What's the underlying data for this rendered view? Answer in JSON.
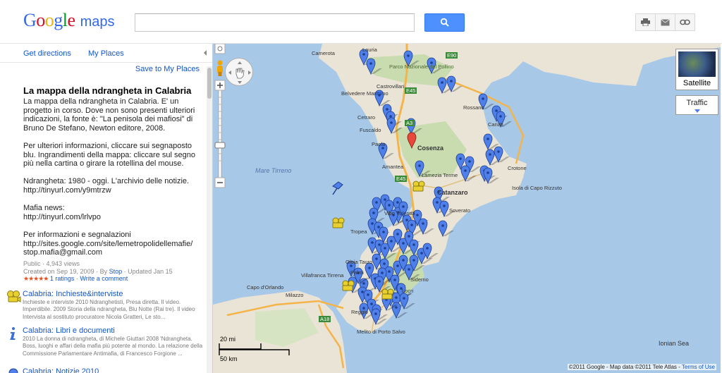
{
  "header": {
    "logo_text": "Google",
    "logo_suffix": "maps",
    "search": {
      "value": "",
      "placeholder": ""
    },
    "search_button_icon": "search-icon",
    "tools": [
      "print-icon",
      "email-icon",
      "link-icon"
    ]
  },
  "panel": {
    "tabs": [
      "Get directions",
      "My Places"
    ],
    "save_link": "Save to My Places",
    "title": "La mappa della ndrangheta in Calabria",
    "description": [
      "La mappa della ndrangheta in Calabria. E' un progetto in corso. Dove non sono presenti ulteriori indicazioni, la fonte è: \"La penisola dei mafiosi\" di Bruno De Stefano, Newton editore, 2008.",
      "Per ulteriori informazioni, cliccare sui segnaposto blu. Ingrandimenti della mappa: cliccare sul segno più nella cartina o girare la rotellina del mouse.",
      "Ndrangheta: 1980 - oggi. L'archivio delle notizie.\nhttp://tinyurl.com/y9mtrzw",
      "Mafia news:\nhttp://tinyurl.com/lrlvpo",
      "Per informazioni e segnalazioni\nhttp://sites.google.com/site/lemetropolidellemafie/\nstop.mafia@gmail.com"
    ],
    "meta": {
      "visibility": "Public · 4,943 views",
      "created": "Created on Sep 19, 2009 · By",
      "author": "Stop",
      "updated": "· Updated Jan 15",
      "stars": "★★★★★",
      "ratings": "1 ratings",
      "separator": "·",
      "write_comment": "Write a comment"
    },
    "layers": [
      {
        "title": "Calabria: Inchieste&interviste",
        "text": "Inchieste e interviste 2010 Ndranghetisti, Presa diretta. Il video. Imperdibile. 2009 Storia della ndrangheta, Blu Notte (Rai tre). Il video Intervista al sostituto procuratore Nicola Gratteri, Le sto..."
      },
      {
        "title": "Calabria: Libri e documenti",
        "text": "2010 La donna di ndrangheta, di Michele Giuttari 2008 'Ndrangheta. Boss, luoghi e affari della mafia più potente al mondo. La relazione della Commissione Parlamentare Antimafia, di Francesco Forgione ..."
      },
      {
        "title": "Calabria: Notizie 2010",
        "text": ""
      }
    ]
  },
  "map": {
    "satellite_label": "Satellite",
    "traffic_label": "Traffic",
    "scale": {
      "top": "20 mi",
      "bottom": "50 km"
    },
    "copyright": "©2011 Google - Map data ©2011 Tele Atlas -",
    "terms": "Terms of Use",
    "labels": [
      "Camerota",
      "Lauria",
      "Castrovillari",
      "Belvedere Marittimo",
      "Cetraro",
      "Fuscaldo",
      "Paola",
      "Amantea",
      "Cosenza",
      "Rossano",
      "Cariati",
      "Lamezia Terme",
      "Catanzaro",
      "Isola di Capo Rizzuto",
      "Crotone",
      "Soverato",
      "Vibo Valentia",
      "Tropea",
      "Gioia Tauro",
      "Palmi",
      "Villafranca Tirrena",
      "Capo d'Orlando",
      "Milazzo",
      "Reggio",
      "Melito di Porto Salvo",
      "Locri",
      "Siderno",
      "Ionian Sea",
      "Mare Tirreno",
      "Parco Nazionale del Pollino",
      "E45",
      "E90",
      "A3",
      "E45",
      "A18"
    ],
    "colors": {
      "sea": "#a8c8e8",
      "land": "#eae4d6",
      "forest": "#c8dcb0",
      "highway": "#f3b44a",
      "marker": "#4f7fe8",
      "marker_border": "#1f3f8f"
    }
  }
}
